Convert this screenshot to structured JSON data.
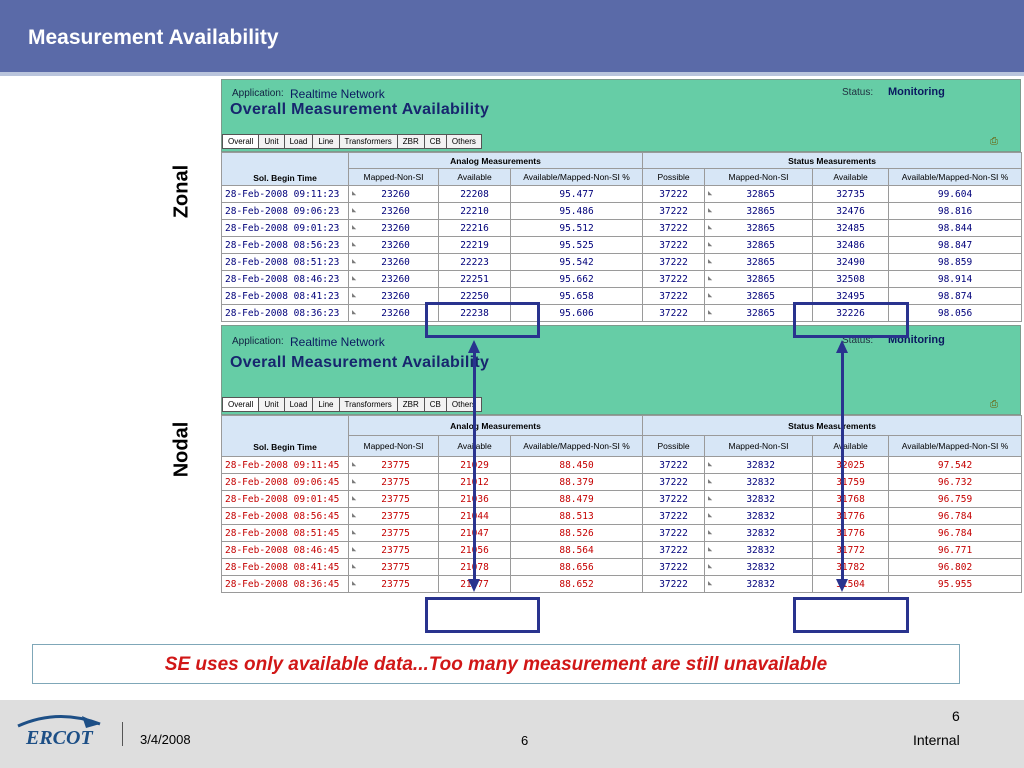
{
  "slide": {
    "title": "Measurement Availability",
    "zonal_label": "Zonal",
    "nodal_label": "Nodal",
    "note": "SE uses only available data...Too many measurement are still unavailable"
  },
  "screen": {
    "application_label": "Application:",
    "application_value": "Realtime Network",
    "status_label": "Status:",
    "status_value": "Monitoring",
    "page_title": "Overall Measurement Availability",
    "tabs": [
      "Overall",
      "Unit",
      "Load",
      "Line",
      "Transformers",
      "ZBR",
      "CB",
      "Others"
    ],
    "group_headers": {
      "analog": "Analog Measurements",
      "status": "Status Measurements"
    },
    "columns": [
      "Sol. Begin Time",
      "Mapped-Non-SI",
      "Available",
      "Available/Mapped-Non-SI  %",
      "Possible",
      "Mapped-Non-SI",
      "Available",
      "Available/Mapped-Non-SI  %"
    ]
  },
  "zonal_rows": [
    [
      "28-Feb-2008 09:11:23",
      "23260",
      "22208",
      "95.477",
      "37222",
      "32865",
      "32735",
      "99.604"
    ],
    [
      "28-Feb-2008 09:06:23",
      "23260",
      "22210",
      "95.486",
      "37222",
      "32865",
      "32476",
      "98.816"
    ],
    [
      "28-Feb-2008 09:01:23",
      "23260",
      "22216",
      "95.512",
      "37222",
      "32865",
      "32485",
      "98.844"
    ],
    [
      "28-Feb-2008 08:56:23",
      "23260",
      "22219",
      "95.525",
      "37222",
      "32865",
      "32486",
      "98.847"
    ],
    [
      "28-Feb-2008 08:51:23",
      "23260",
      "22223",
      "95.542",
      "37222",
      "32865",
      "32490",
      "98.859"
    ],
    [
      "28-Feb-2008 08:46:23",
      "23260",
      "22251",
      "95.662",
      "37222",
      "32865",
      "32508",
      "98.914"
    ],
    [
      "28-Feb-2008 08:41:23",
      "23260",
      "22250",
      "95.658",
      "37222",
      "32865",
      "32495",
      "98.874"
    ],
    [
      "28-Feb-2008 08:36:23",
      "23260",
      "22238",
      "95.606",
      "37222",
      "32865",
      "32226",
      "98.056"
    ]
  ],
  "nodal_rows": [
    [
      "28-Feb-2008 09:11:45",
      "23775",
      "21029",
      "88.450",
      "37222",
      "32832",
      "32025",
      "97.542"
    ],
    [
      "28-Feb-2008 09:06:45",
      "23775",
      "21012",
      "88.379",
      "37222",
      "32832",
      "31759",
      "96.732"
    ],
    [
      "28-Feb-2008 09:01:45",
      "23775",
      "21036",
      "88.479",
      "37222",
      "32832",
      "31768",
      "96.759"
    ],
    [
      "28-Feb-2008 08:56:45",
      "23775",
      "21044",
      "88.513",
      "37222",
      "32832",
      "31776",
      "96.784"
    ],
    [
      "28-Feb-2008 08:51:45",
      "23775",
      "21047",
      "88.526",
      "37222",
      "32832",
      "31776",
      "96.784"
    ],
    [
      "28-Feb-2008 08:46:45",
      "23775",
      "21056",
      "88.564",
      "37222",
      "32832",
      "31772",
      "96.771"
    ],
    [
      "28-Feb-2008 08:41:45",
      "23775",
      "21078",
      "88.656",
      "37222",
      "32832",
      "31782",
      "96.802"
    ],
    [
      "28-Feb-2008 08:36:45",
      "23775",
      "21077",
      "88.652",
      "37222",
      "32832",
      "31504",
      "95.955"
    ]
  ],
  "footer": {
    "logo_text": "ERCOT",
    "date": "3/4/2008",
    "page": "6",
    "slide_number": "6",
    "classification": "Internal"
  },
  "colors": {
    "title_bar": "#5a6aa8",
    "app_header": "#66cda6",
    "highlight": "#29338e",
    "note_text": "#d11717",
    "nodal_text": "#c40000"
  }
}
